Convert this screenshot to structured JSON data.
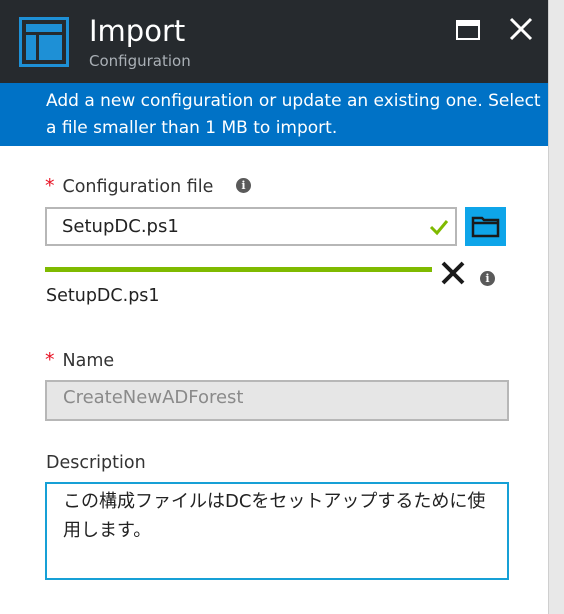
{
  "header": {
    "title": "Import",
    "subtitle": "Configuration",
    "icon": "blade-icon",
    "colors": {
      "bg": "#262a2e",
      "icon": "#1e90d6"
    }
  },
  "banner": {
    "text": "Add a new configuration or update an existing one. Select a file smaller than 1 MB to import.",
    "color": "#0072c6"
  },
  "config_file": {
    "label": "Configuration file",
    "required_mark": "*",
    "value": "SetupDC.ps1",
    "upload_progress": 1.0,
    "uploaded_name": "SetupDC.ps1"
  },
  "name": {
    "label": "Name",
    "required_mark": "*",
    "value": "CreateNewADForest"
  },
  "description": {
    "label": "Description",
    "value": "この構成ファイルはDCをセットアップするために使用します。"
  }
}
